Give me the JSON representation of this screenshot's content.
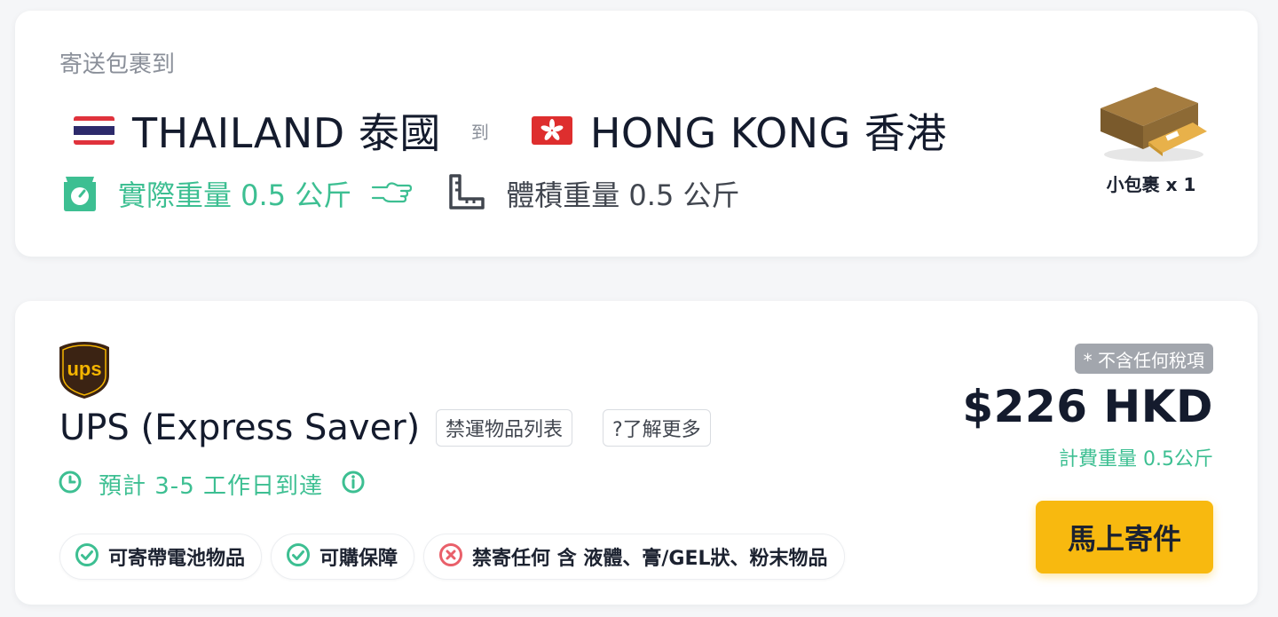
{
  "route": {
    "send_label": "寄送包裹到",
    "origin": "THAILAND 泰國",
    "to_word": "到",
    "destination": "HONG KONG 香港",
    "actual_weight": "實際重量 0.5 公斤",
    "volumetric_weight": "體積重量 0.5 公斤",
    "parcel_label": "小包裹 x 1"
  },
  "quote": {
    "carrier_logo_text": "ups",
    "carrier_name": "UPS (Express Saver)",
    "prohibited_list_label": "禁運物品列表",
    "learn_more_label": "?了解更多",
    "eta": "預計 3-5 工作日到達",
    "tax_badge": "* 不含任何稅項",
    "price": "$226 HKD",
    "billing_weight": "計費重量 0.5公斤",
    "ship_button": "馬上寄件",
    "features": [
      {
        "status": "allowed",
        "label": "可寄帶電池物品"
      },
      {
        "status": "allowed",
        "label": "可購保障"
      },
      {
        "status": "prohibited",
        "label": "禁寄任何 含 液體、膏/GEL狀、粉末物品"
      }
    ]
  },
  "colors": {
    "accent_green": "#3dbf92",
    "button_yellow": "#f8b90f",
    "prohibited_red": "#e9606a",
    "ups_brown": "#3b2313",
    "ups_gold": "#f5b500"
  }
}
